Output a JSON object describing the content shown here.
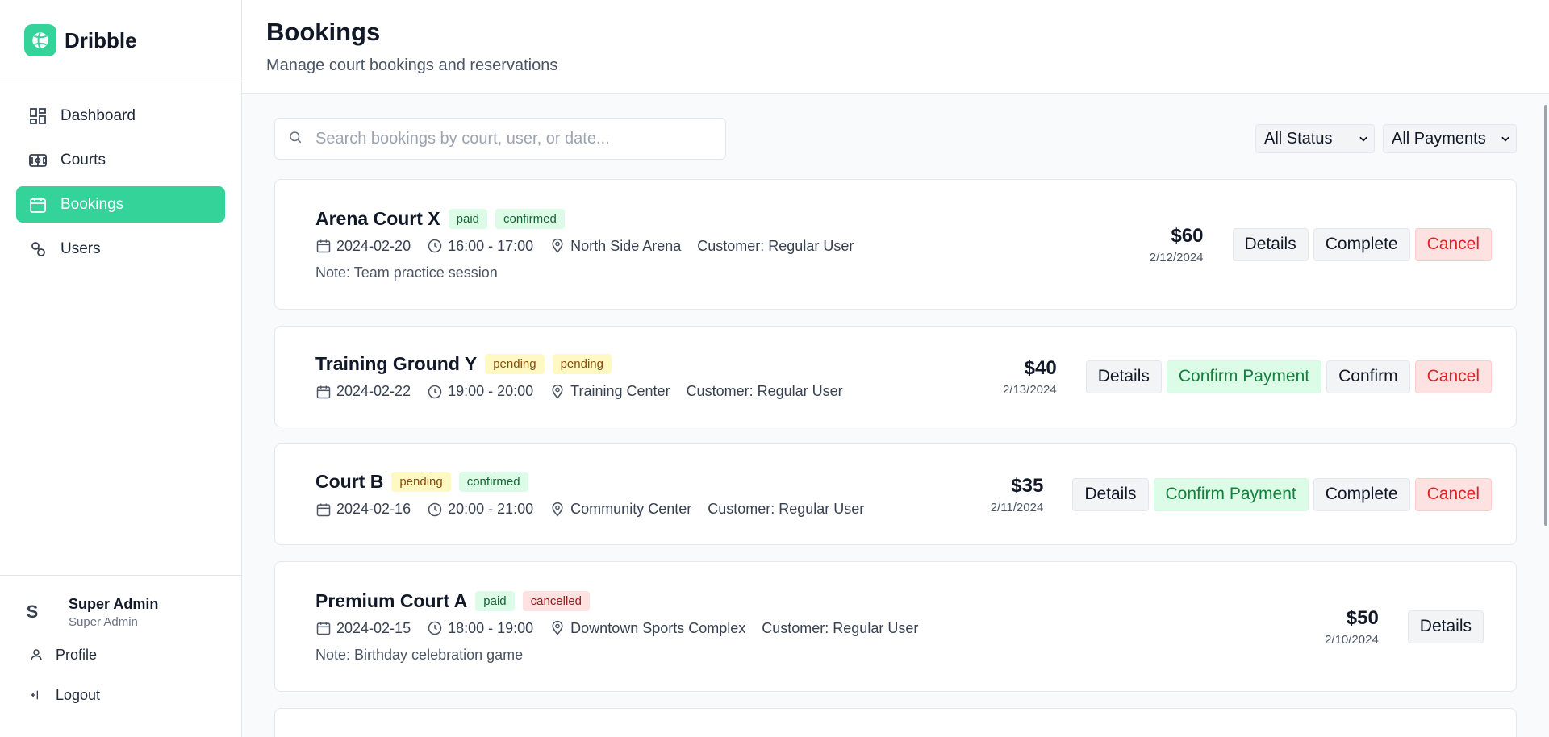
{
  "brand": {
    "name": "Dribble"
  },
  "nav": {
    "items": [
      {
        "label": "Dashboard",
        "icon": "dashboard-icon"
      },
      {
        "label": "Courts",
        "icon": "court-icon"
      },
      {
        "label": "Bookings",
        "icon": "calendar-icon",
        "active": true
      },
      {
        "label": "Users",
        "icon": "users-icon"
      }
    ]
  },
  "user": {
    "initial": "S",
    "name": "Super Admin",
    "role": "Super Admin"
  },
  "footer": {
    "profile_label": "Profile",
    "logout_label": "Logout"
  },
  "header": {
    "title": "Bookings",
    "subtitle": "Manage court bookings and reservations"
  },
  "search": {
    "placeholder": "Search bookings by court, user, or date...",
    "value": ""
  },
  "filters": {
    "status": "All Status",
    "payment": "All Payments"
  },
  "bookings": [
    {
      "court": "Arena Court X",
      "payment_badge": "paid",
      "status_badge": "confirmed",
      "date": "2024-02-20",
      "time": "16:00 - 17:00",
      "location": "North Side Arena",
      "customer": "Customer: Regular User",
      "note": "Note: Team practice session",
      "price": "$60",
      "created": "2/12/2024",
      "actions": [
        "Details",
        "Complete",
        "Cancel"
      ]
    },
    {
      "court": "Training Ground Y",
      "payment_badge": "pending",
      "status_badge": "pending",
      "date": "2024-02-22",
      "time": "19:00 - 20:00",
      "location": "Training Center",
      "customer": "Customer: Regular User",
      "price": "$40",
      "created": "2/13/2024",
      "actions": [
        "Details",
        "Confirm Payment",
        "Confirm",
        "Cancel"
      ]
    },
    {
      "court": "Court B",
      "payment_badge": "pending",
      "status_badge": "confirmed",
      "date": "2024-02-16",
      "time": "20:00 - 21:00",
      "location": "Community Center",
      "customer": "Customer: Regular User",
      "price": "$35",
      "created": "2/11/2024",
      "actions": [
        "Details",
        "Confirm Payment",
        "Complete",
        "Cancel"
      ]
    },
    {
      "court": "Premium Court A",
      "payment_badge": "paid",
      "status_badge": "cancelled",
      "date": "2024-02-15",
      "time": "18:00 - 19:00",
      "location": "Downtown Sports Complex",
      "customer": "Customer: Regular User",
      "note": "Note: Birthday celebration game",
      "price": "$50",
      "created": "2/10/2024",
      "actions": [
        "Details"
      ]
    }
  ],
  "colors": {
    "accent": "#34d399",
    "paid": "#dcfce7",
    "pending": "#fef9c3",
    "cancelled": "#fee2e2"
  }
}
